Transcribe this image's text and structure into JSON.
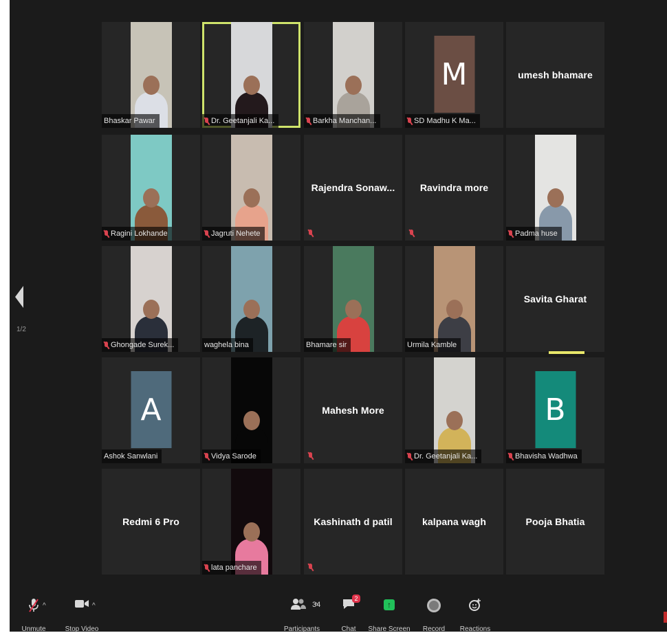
{
  "grid": [
    {
      "name": "Bhaskar Pawar",
      "mode": "video",
      "muted": false,
      "bg": "#c7c3b7",
      "body": "#dcdfe6"
    },
    {
      "name": "Dr. Geetanjali Ka...",
      "mode": "video",
      "muted": true,
      "active": true,
      "bg": "#d7d8da",
      "body": "#23191c"
    },
    {
      "name": "Barkha Manchan...",
      "mode": "video",
      "muted": true,
      "bg": "#d2d0cc",
      "body": "#a9a39b"
    },
    {
      "name": "SD Madhu K Ma...",
      "mode": "avatar",
      "muted": true,
      "letter": "M",
      "color": "#6b4e44"
    },
    {
      "name": "umesh bhamare",
      "mode": "name-only",
      "muted": false
    },
    {
      "name": "Ragini Lokhande",
      "mode": "video",
      "muted": true,
      "bg": "#7ec9c4",
      "body": "#8a5a3b"
    },
    {
      "name": "Jagruti Nehete",
      "mode": "video",
      "muted": true,
      "bg": "#c8bcb0",
      "body": "#e7a38c"
    },
    {
      "name": "Rajendra  Sonaw...",
      "mode": "name-only",
      "muted": true
    },
    {
      "name": "Ravindra more",
      "mode": "name-only",
      "muted": true
    },
    {
      "name": "Padma huse",
      "mode": "video",
      "muted": true,
      "bg": "#e4e4e2",
      "body": "#8899aa"
    },
    {
      "name": "Ghongade Surek...",
      "mode": "video",
      "muted": true,
      "bg": "#d7d2cf",
      "body": "#2a2f3a"
    },
    {
      "name": "waghela bina",
      "mode": "video",
      "muted": false,
      "bg": "#7ea2ad",
      "body": "#1d2326"
    },
    {
      "name": "Bhamare sir",
      "mode": "video",
      "muted": false,
      "bg": "#4a7a5e",
      "body": "#d8423f"
    },
    {
      "name": "Urmila Kamble",
      "mode": "video",
      "muted": false,
      "bg": "#b89476",
      "body": "#3d3e45"
    },
    {
      "name": "Savita Gharat",
      "mode": "name-only",
      "muted": false
    },
    {
      "name": "Ashok Sanwlani",
      "mode": "avatar",
      "muted": false,
      "letter": "A",
      "color": "#4f6a7b"
    },
    {
      "name": "Vidya Sarode",
      "mode": "video",
      "muted": true,
      "bg": "#070707",
      "body": "#070707"
    },
    {
      "name": "Mahesh More",
      "mode": "name-only",
      "muted": true
    },
    {
      "name": "Dr. Geetanjali Ka...",
      "mode": "video",
      "muted": true,
      "bg": "#d4d3cf",
      "body": "#d2b35a"
    },
    {
      "name": "Bhavisha Wadhwa",
      "mode": "avatar",
      "muted": true,
      "letter": "B",
      "color": "#148a7a"
    },
    {
      "name": "Redmi 6 Pro",
      "mode": "name-only",
      "muted": false
    },
    {
      "name": "lata panchare",
      "mode": "video",
      "muted": true,
      "bg": "#120a0d",
      "body": "#e77a9e"
    },
    {
      "name": "Kashinath  d  patil",
      "mode": "name-only",
      "muted": true
    },
    {
      "name": "kalpana wagh",
      "mode": "name-only",
      "muted": false
    },
    {
      "name": "Pooja Bhatia",
      "mode": "name-only",
      "muted": false
    }
  ],
  "pagination": {
    "indicator": "1/2"
  },
  "toolbar": {
    "unmute": "Unmute",
    "stop_video": "Stop Video",
    "participants": "Participants",
    "participant_count": "34",
    "chat": "Chat",
    "chat_badge": "2",
    "share_screen": "Share Screen",
    "record": "Record",
    "reactions": "Reactions"
  }
}
